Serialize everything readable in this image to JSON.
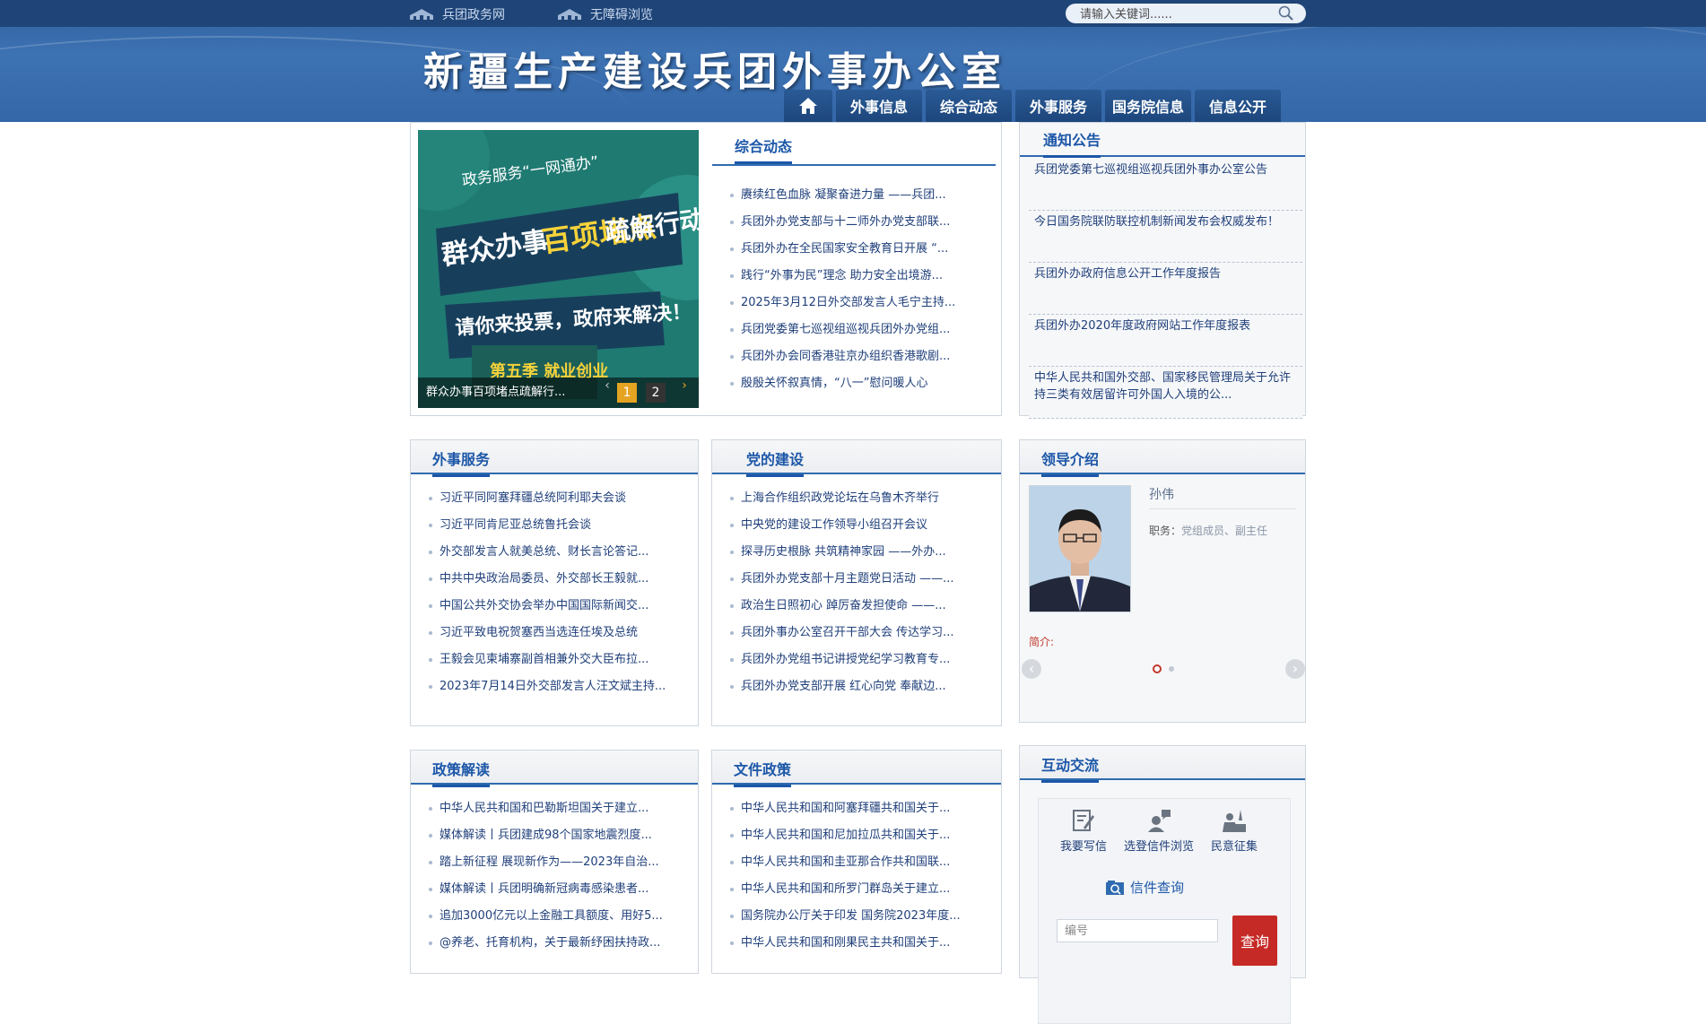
{
  "topbar": {
    "links": [
      {
        "label": "兵团政务网",
        "icon": "building-icon"
      },
      {
        "label": "无障碍浏览",
        "icon": "building-icon"
      }
    ],
    "search_placeholder": "请输入关键词......"
  },
  "header": {
    "site_title": "新疆生产建设兵团外事办公室",
    "nav": [
      {
        "label": "",
        "icon": "home-icon"
      },
      {
        "label": "外事信息"
      },
      {
        "label": "综合动态"
      },
      {
        "label": "外事服务"
      },
      {
        "label": "国务院信息"
      },
      {
        "label": "信息公开"
      }
    ]
  },
  "slideshow": {
    "banner_lines": [
      "政务服务“一网通办”",
      "群众办事",
      "百项堵点",
      "疏解行动",
      "请你来投票，政府来解决！",
      "第五季 就业创业"
    ],
    "caption": "群众办事百项堵点疏解行...",
    "pages": [
      "1",
      "2"
    ],
    "active_page": 1
  },
  "zonghe": {
    "title": "综合动态",
    "items": [
      "赓续红色血脉 凝聚奋进力量 ——兵团...",
      "兵团外办党支部与十二师外办党支部联...",
      "兵团外办在全民国家安全教育日开展 “...",
      "践行“外事为民”理念 助力安全出境游...",
      "2025年3月12日外交部发言人毛宁主持...",
      "兵团党委第七巡视组巡视兵团外办党组...",
      "兵团外办会同香港驻京办组织香港歌剧...",
      "殷殷关怀叙真情，“八一”慰问暖人心"
    ]
  },
  "notice": {
    "title": "通知公告",
    "items": [
      "兵团党委第七巡视组巡视兵团外事办公室公告",
      "今日国务院联防联控机制新闻发布会权威发布！",
      "兵团外办政府信息公开工作年度报告",
      "兵团外办2020年度政府网站工作年度报表",
      "中华人民共和国外交部、国家移民管理局关于允许持三类有效居留许可外国人入境的公..."
    ]
  },
  "waishi": {
    "title": "外事服务",
    "items": [
      "习近平同阿塞拜疆总统阿利耶夫会谈",
      "习近平同肯尼亚总统鲁托会谈",
      "外交部发言人就美总统、财长言论答记...",
      "中共中央政治局委员、外交部长王毅就...",
      "中国公共外交协会举办中国国际新闻交...",
      "习近平致电祝贺塞西当选连任埃及总统",
      "王毅会见柬埔寨副首相兼外交大臣布拉...",
      "2023年7月14日外交部发言人汪文斌主持..."
    ]
  },
  "dangjian": {
    "title": "党的建设",
    "items": [
      "上海合作组织政党论坛在乌鲁木齐举行",
      "中央党的建设工作领导小组召开会议",
      "探寻历史根脉 共筑精神家园 ——外办...",
      "兵团外办党支部十月主题党日活动 ——...",
      "政治生日照初心 踔厉奋发担使命 ——...",
      "兵团外事办公室召开干部大会 传达学习...",
      "兵团外办党组书记讲授党纪学习教育专...",
      "兵团外办党支部开展 红心向党 奉献边..."
    ]
  },
  "leader": {
    "title": "领导介绍",
    "name": "孙伟",
    "duty_label": "职务：",
    "duty_value": "党组成员、副主任",
    "intro_label": "简介:",
    "page_count": 2,
    "active_page": 1
  },
  "zhengce": {
    "title": "政策解读",
    "items": [
      "中华人民共和国和巴勒斯坦国关于建立...",
      "媒体解读丨兵团建成98个国家地震烈度...",
      "踏上新征程 展现新作为——2023年自治...",
      "媒体解读丨兵团明确新冠病毒感染患者...",
      "追加3000亿元以上金融工具额度、用好5...",
      "@养老、托育机构，关于最新纾困扶持政..."
    ]
  },
  "wenjian": {
    "title": "文件政策",
    "items": [
      "中华人民共和国和阿塞拜疆共和国关于...",
      "中华人民共和国和尼加拉瓜共和国关于...",
      "中华人民共和国和圭亚那合作共和国联...",
      "中华人民共和国和所罗门群岛关于建立...",
      "国务院办公厅关于印发 国务院2023年度...",
      "中华人民共和国和刚果民主共和国关于..."
    ]
  },
  "interact": {
    "title": "互动交流",
    "actions": [
      {
        "label": "我要写信",
        "icon": "write-letter-icon"
      },
      {
        "label": "选登信件浏览",
        "icon": "letter-browse-icon"
      },
      {
        "label": "民意征集",
        "icon": "opinion-icon"
      }
    ],
    "query_label": "信件查询",
    "query_placeholder": "编号",
    "query_button": "查询"
  },
  "colors": {
    "brand_blue": "#2f6bb0",
    "header_blue": "#3467a8",
    "accent_red": "#c62a26",
    "text_blue": "#1f3f7a"
  }
}
